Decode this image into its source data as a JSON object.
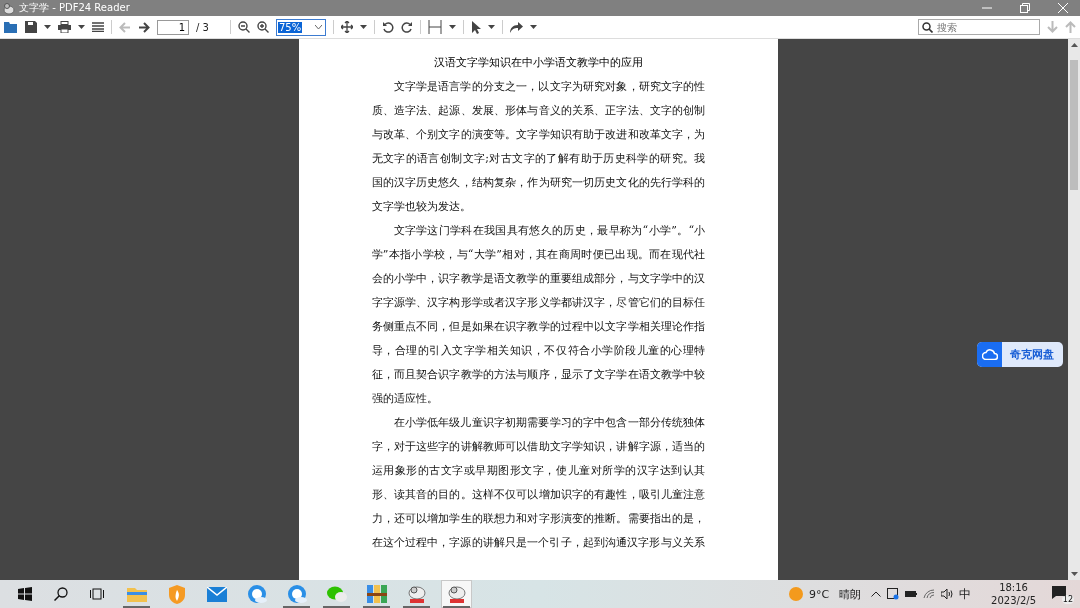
{
  "window": {
    "title": "文字学 - PDF24 Reader"
  },
  "toolbar": {
    "page": "1",
    "page_total": "/ 3",
    "zoom": "75%",
    "search_placeholder": "搜索"
  },
  "document": {
    "title": "汉语文字学知识在中小学语文教学中的应用",
    "paragraphs": [
      "文字学是语言学的分支之一，以文字为研究对象，研究文字的性质、造字法、起源、发展、形体与音义的关系、正字法、文字的创制与改革、个别文字的演变等。文字学知识有助于改进和改革文字，为无文字的语言创制文字;对古文字的了解有助于历史科学的研究。我国的汉字历史悠久，结构复杂，作为研究一切历史文化的先行学科的文字学也较为发达。",
      "文字学这门学科在我国具有悠久的历史，最早称为“小学”。“小学”本指小学校，与“大学”相对，其在商周时便已出现。而在现代社会的小学中，识字教学是语文教学的重要组成部分，与文字学中的汉字字源学、汉字构形学或者汉字形义学都讲汉字，尽管它们的目标任务侧重点不同，但是如果在识字教学的过程中以文字学相关理论作指导，合理的引入文字学相关知识，不仅符合小学阶段儿童的心理特征，而且契合识字教学的方法与顺序，显示了文字学在语文教学中较强的适应性。",
      "在小学低年级儿童识字初期需要学习的字中包含一部分传统独体字，对于这些字的讲解教师可以借助文字学知识，讲解字源，适当的运用象形的古文字或早期图形文字，使儿童对所学的汉字达到认其形、读其音的目的。这样不仅可以增加识字的有趣性，吸引儿童注意力，还可以增加学生的联想力和对字形演变的推断。需要指出的是，在这个过程中，字源的讲解只是一个引子，起到沟通汉字形与义关系"
    ]
  },
  "floating_button": {
    "label": "奇克网盘"
  },
  "taskbar": {
    "apps": [
      {
        "kind": "folder",
        "running": true,
        "selected": false
      },
      {
        "kind": "shield",
        "running": false,
        "selected": false
      },
      {
        "kind": "mail",
        "running": false,
        "selected": false
      },
      {
        "kind": "browser",
        "running": false,
        "selected": false
      },
      {
        "kind": "browser",
        "running": true,
        "selected": false
      },
      {
        "kind": "chat",
        "running": true,
        "selected": false
      },
      {
        "kind": "archive",
        "running": true,
        "selected": false
      },
      {
        "kind": "pdf",
        "running": true,
        "selected": false
      },
      {
        "kind": "pdf",
        "running": true,
        "selected": true
      }
    ],
    "weather": {
      "temperature": "9°C",
      "condition": "晴朗"
    },
    "ime": "中",
    "time": "18:16",
    "date": "2023/2/5",
    "notifications": "12"
  }
}
